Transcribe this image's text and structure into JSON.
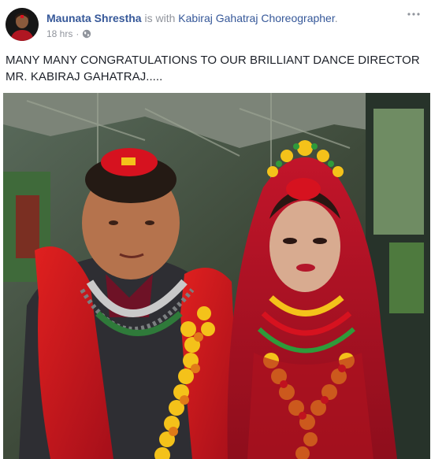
{
  "post": {
    "author_name": "Maunata Shrestha",
    "with_text": "is with",
    "tagged_name": "Kabiraj Gahatraj Choreographer",
    "tagged_suffix": ".",
    "timestamp": "18 hrs",
    "separator": "·",
    "privacy_icon": "globe-icon",
    "more_icon": "more-options-icon",
    "message": "MANY MANY CONGRATULATIONS TO OUR BRILLIANT DANCE DIRECTOR\nMR. KABIRAJ GAHATRAJ.....",
    "photo_icon": "wedding-photo"
  },
  "colors": {
    "link_blue": "#365899",
    "meta_gray": "#90949c",
    "text_dark": "#1d2129",
    "sindoor_red": "#d6121f",
    "garland_yellow": "#f4c21a"
  }
}
